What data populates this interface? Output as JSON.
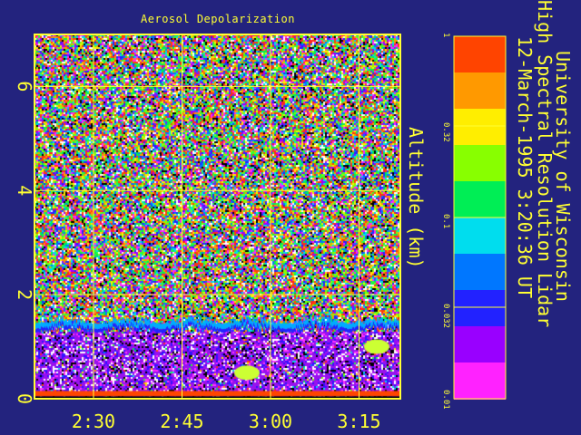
{
  "chart_data": {
    "type": "heatmap",
    "title": "Aerosol Depolarization",
    "ylabel": "Altitude (km)",
    "xlabel": "",
    "x_ticks": [
      "2:30",
      "2:45",
      "3:00",
      "3:15"
    ],
    "x_tick_minutes": [
      150,
      165,
      180,
      195
    ],
    "xlim_minutes": [
      140,
      202
    ],
    "y_ticks": [
      "0",
      "2",
      "4",
      "6"
    ],
    "y_tick_values": [
      0,
      2,
      4,
      6
    ],
    "ylim": [
      0,
      7
    ],
    "grid": true,
    "colorbar": {
      "scale": "log",
      "ticks": [
        "1",
        "0.32",
        "0.1",
        "0.032",
        "0.01"
      ],
      "tick_values": [
        1,
        0.32,
        0.1,
        0.032,
        0.01
      ],
      "range": [
        0.01,
        1
      ],
      "colors": [
        "#ff4400",
        "#ff9900",
        "#ffee00",
        "#88ff00",
        "#00ee55",
        "#00ddee",
        "#0077ff",
        "#2222ff",
        "#9900ff",
        "#ff22ff"
      ]
    },
    "features": [
      {
        "name": "aerosol layer top",
        "altitude_km": 1.3
      },
      {
        "name": "low cloud",
        "time_minutes": 176,
        "altitude_km": 0.5
      },
      {
        "name": "low cloud",
        "time_minutes": 198,
        "altitude_km": 1.0
      }
    ]
  },
  "info": {
    "line1": "University of Wisconsin",
    "line2": "High Spectral Resolution Lidar",
    "line3": "12-March-1995   3:20:36 UT"
  },
  "colors": {
    "background": "#23237e",
    "axis": "#ffff33"
  }
}
